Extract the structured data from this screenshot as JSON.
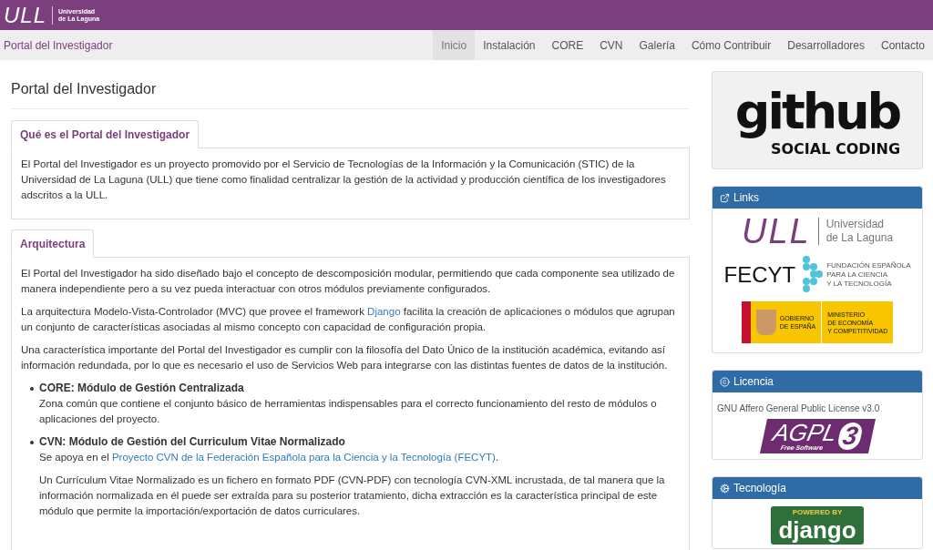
{
  "header": {
    "logo_mark": "ULL",
    "logo_lines": [
      "Universidad",
      "de La Laguna"
    ]
  },
  "navbar": {
    "brand": "Portal del Investigador",
    "items": [
      {
        "label": "Inicio",
        "selected": true
      },
      {
        "label": "Instalación",
        "selected": false
      },
      {
        "label": "CORE",
        "selected": false
      },
      {
        "label": "CVN",
        "selected": false
      },
      {
        "label": "Galería",
        "selected": false
      },
      {
        "label": "Cómo Contribuir",
        "selected": false
      },
      {
        "label": "Desarrolladores",
        "selected": false
      },
      {
        "label": "Contacto",
        "selected": false
      }
    ]
  },
  "main": {
    "title": "Portal del Investigador",
    "sections": [
      {
        "tab": "Qué es el Portal del Investigador",
        "blocks": [
          {
            "kind": "paragraph",
            "parts": [
              {
                "text": "El Portal del Investigador es un proyecto promovido por el Servicio de Tecnologías de la Información y la Comunicación (STIC) de la Universidad de La Laguna (ULL) que tiene como finalidad centralizar la gestión de la actividad y producción científica de los investigadores adscritos a la ULL."
              }
            ]
          }
        ]
      },
      {
        "tab": "Arquitectura",
        "blocks": [
          {
            "kind": "paragraph",
            "parts": [
              {
                "text": "El Portal del Investigador ha sido diseñado bajo el concepto de descomposición modular, permitiendo que cada componente sea utilizado de manera independiente pero a su vez pueda interactuar con otros módulos previamente configurados."
              }
            ]
          },
          {
            "kind": "paragraph",
            "parts": [
              {
                "text": "La arquitectura Modelo-Vista-Controlador (MVC) que provee el framework "
              },
              {
                "link": "Django"
              },
              {
                "text": " facilita la creación de aplicaciones o módulos que agrupan un conjunto de características asociadas al mismo concepto con capacidad de configuración propia."
              }
            ]
          },
          {
            "kind": "paragraph",
            "parts": [
              {
                "text": "Una característica importante del Portal del Investigador es cumplir con la filosofía del Dato Único de la institución académica, evitando así información redundada, por lo que es necesario el uso de Servicios Web para integrarse con las distintas fuentes de datos de la institución."
              }
            ]
          },
          {
            "kind": "list",
            "items": [
              {
                "heading": "CORE: Módulo de Gestión Centralizada",
                "paragraphs": [
                  [
                    {
                      "text": "Zona común que contiene el conjunto básico de herramientas indispensables para el correcto funcionamiento del resto de módulos o aplicaciones del proyecto."
                    }
                  ]
                ]
              },
              {
                "heading": "CVN: Módulo de Gestión del Curriculum Vitae Normalizado",
                "paragraphs": [
                  [
                    {
                      "text": "Se apoya en el "
                    },
                    {
                      "link": "Proyecto CVN de la Federación Española para la Ciencia y la Tecnología (FECYT)"
                    },
                    {
                      "text": "."
                    }
                  ],
                  [
                    {
                      "text": "Un Currículum Vitae Normalizado es un fichero en formato PDF (CVN-PDF) con tecnología CVN-XML incrustada, de tal manera que la información normalizada en él puede ser extraída para su posterior tratamiento, dicha extracción es la característica principal de este módulo que permite la importación/exportación de datos curriculares."
                    }
                  ]
                ]
              }
            ]
          }
        ]
      }
    ]
  },
  "sidebar": [
    {
      "kind": "github",
      "logo": "github",
      "tagline": "SOCIAL CODING"
    },
    {
      "kind": "links",
      "title": "Links",
      "logos": [
        {
          "kind": "ull",
          "mark": "ULL",
          "lines": [
            "Universidad",
            "de La Laguna"
          ]
        },
        {
          "kind": "fecyt",
          "mark": "FECYT",
          "lines": [
            "FUNDACIÓN ESPAÑOLA",
            "PARA LA CIENCIA",
            "Y LA TECNOLOGÍA"
          ]
        },
        {
          "kind": "gobierno",
          "left": [
            "GOBIERNO",
            "DE ESPAÑA"
          ],
          "right": [
            "MINISTERIO",
            "DE ECONOMÍA",
            "Y COMPETITIVIDAD"
          ]
        }
      ]
    },
    {
      "kind": "license",
      "title": "Licencia",
      "text": "GNU Affero General Public License v3.0",
      "badge": "AGPL",
      "version": "3",
      "badge_sub": "Free Software"
    },
    {
      "kind": "tech",
      "title": "Tecnología",
      "badge_top": "POWERED BY",
      "badge": "django"
    }
  ]
}
